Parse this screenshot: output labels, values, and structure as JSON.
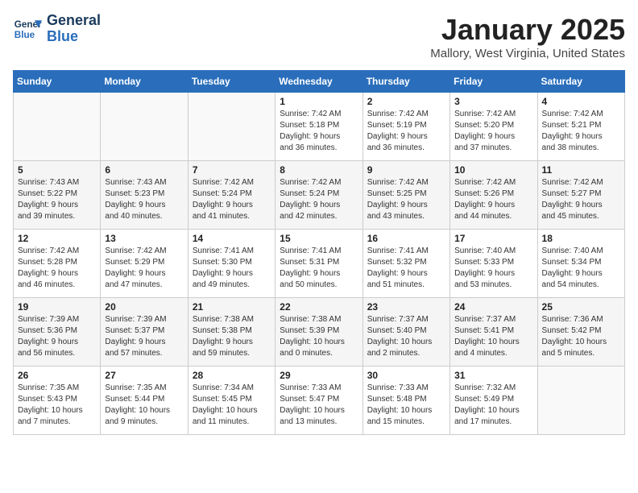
{
  "logo": {
    "line1": "General",
    "line2": "Blue"
  },
  "title": "January 2025",
  "subtitle": "Mallory, West Virginia, United States",
  "weekdays": [
    "Sunday",
    "Monday",
    "Tuesday",
    "Wednesday",
    "Thursday",
    "Friday",
    "Saturday"
  ],
  "weeks": [
    [
      {
        "day": "",
        "info": ""
      },
      {
        "day": "",
        "info": ""
      },
      {
        "day": "",
        "info": ""
      },
      {
        "day": "1",
        "info": "Sunrise: 7:42 AM\nSunset: 5:18 PM\nDaylight: 9 hours\nand 36 minutes."
      },
      {
        "day": "2",
        "info": "Sunrise: 7:42 AM\nSunset: 5:19 PM\nDaylight: 9 hours\nand 36 minutes."
      },
      {
        "day": "3",
        "info": "Sunrise: 7:42 AM\nSunset: 5:20 PM\nDaylight: 9 hours\nand 37 minutes."
      },
      {
        "day": "4",
        "info": "Sunrise: 7:42 AM\nSunset: 5:21 PM\nDaylight: 9 hours\nand 38 minutes."
      }
    ],
    [
      {
        "day": "5",
        "info": "Sunrise: 7:43 AM\nSunset: 5:22 PM\nDaylight: 9 hours\nand 39 minutes."
      },
      {
        "day": "6",
        "info": "Sunrise: 7:43 AM\nSunset: 5:23 PM\nDaylight: 9 hours\nand 40 minutes."
      },
      {
        "day": "7",
        "info": "Sunrise: 7:42 AM\nSunset: 5:24 PM\nDaylight: 9 hours\nand 41 minutes."
      },
      {
        "day": "8",
        "info": "Sunrise: 7:42 AM\nSunset: 5:24 PM\nDaylight: 9 hours\nand 42 minutes."
      },
      {
        "day": "9",
        "info": "Sunrise: 7:42 AM\nSunset: 5:25 PM\nDaylight: 9 hours\nand 43 minutes."
      },
      {
        "day": "10",
        "info": "Sunrise: 7:42 AM\nSunset: 5:26 PM\nDaylight: 9 hours\nand 44 minutes."
      },
      {
        "day": "11",
        "info": "Sunrise: 7:42 AM\nSunset: 5:27 PM\nDaylight: 9 hours\nand 45 minutes."
      }
    ],
    [
      {
        "day": "12",
        "info": "Sunrise: 7:42 AM\nSunset: 5:28 PM\nDaylight: 9 hours\nand 46 minutes."
      },
      {
        "day": "13",
        "info": "Sunrise: 7:42 AM\nSunset: 5:29 PM\nDaylight: 9 hours\nand 47 minutes."
      },
      {
        "day": "14",
        "info": "Sunrise: 7:41 AM\nSunset: 5:30 PM\nDaylight: 9 hours\nand 49 minutes."
      },
      {
        "day": "15",
        "info": "Sunrise: 7:41 AM\nSunset: 5:31 PM\nDaylight: 9 hours\nand 50 minutes."
      },
      {
        "day": "16",
        "info": "Sunrise: 7:41 AM\nSunset: 5:32 PM\nDaylight: 9 hours\nand 51 minutes."
      },
      {
        "day": "17",
        "info": "Sunrise: 7:40 AM\nSunset: 5:33 PM\nDaylight: 9 hours\nand 53 minutes."
      },
      {
        "day": "18",
        "info": "Sunrise: 7:40 AM\nSunset: 5:34 PM\nDaylight: 9 hours\nand 54 minutes."
      }
    ],
    [
      {
        "day": "19",
        "info": "Sunrise: 7:39 AM\nSunset: 5:36 PM\nDaylight: 9 hours\nand 56 minutes."
      },
      {
        "day": "20",
        "info": "Sunrise: 7:39 AM\nSunset: 5:37 PM\nDaylight: 9 hours\nand 57 minutes."
      },
      {
        "day": "21",
        "info": "Sunrise: 7:38 AM\nSunset: 5:38 PM\nDaylight: 9 hours\nand 59 minutes."
      },
      {
        "day": "22",
        "info": "Sunrise: 7:38 AM\nSunset: 5:39 PM\nDaylight: 10 hours\nand 0 minutes."
      },
      {
        "day": "23",
        "info": "Sunrise: 7:37 AM\nSunset: 5:40 PM\nDaylight: 10 hours\nand 2 minutes."
      },
      {
        "day": "24",
        "info": "Sunrise: 7:37 AM\nSunset: 5:41 PM\nDaylight: 10 hours\nand 4 minutes."
      },
      {
        "day": "25",
        "info": "Sunrise: 7:36 AM\nSunset: 5:42 PM\nDaylight: 10 hours\nand 5 minutes."
      }
    ],
    [
      {
        "day": "26",
        "info": "Sunrise: 7:35 AM\nSunset: 5:43 PM\nDaylight: 10 hours\nand 7 minutes."
      },
      {
        "day": "27",
        "info": "Sunrise: 7:35 AM\nSunset: 5:44 PM\nDaylight: 10 hours\nand 9 minutes."
      },
      {
        "day": "28",
        "info": "Sunrise: 7:34 AM\nSunset: 5:45 PM\nDaylight: 10 hours\nand 11 minutes."
      },
      {
        "day": "29",
        "info": "Sunrise: 7:33 AM\nSunset: 5:47 PM\nDaylight: 10 hours\nand 13 minutes."
      },
      {
        "day": "30",
        "info": "Sunrise: 7:33 AM\nSunset: 5:48 PM\nDaylight: 10 hours\nand 15 minutes."
      },
      {
        "day": "31",
        "info": "Sunrise: 7:32 AM\nSunset: 5:49 PM\nDaylight: 10 hours\nand 17 minutes."
      },
      {
        "day": "",
        "info": ""
      }
    ]
  ]
}
